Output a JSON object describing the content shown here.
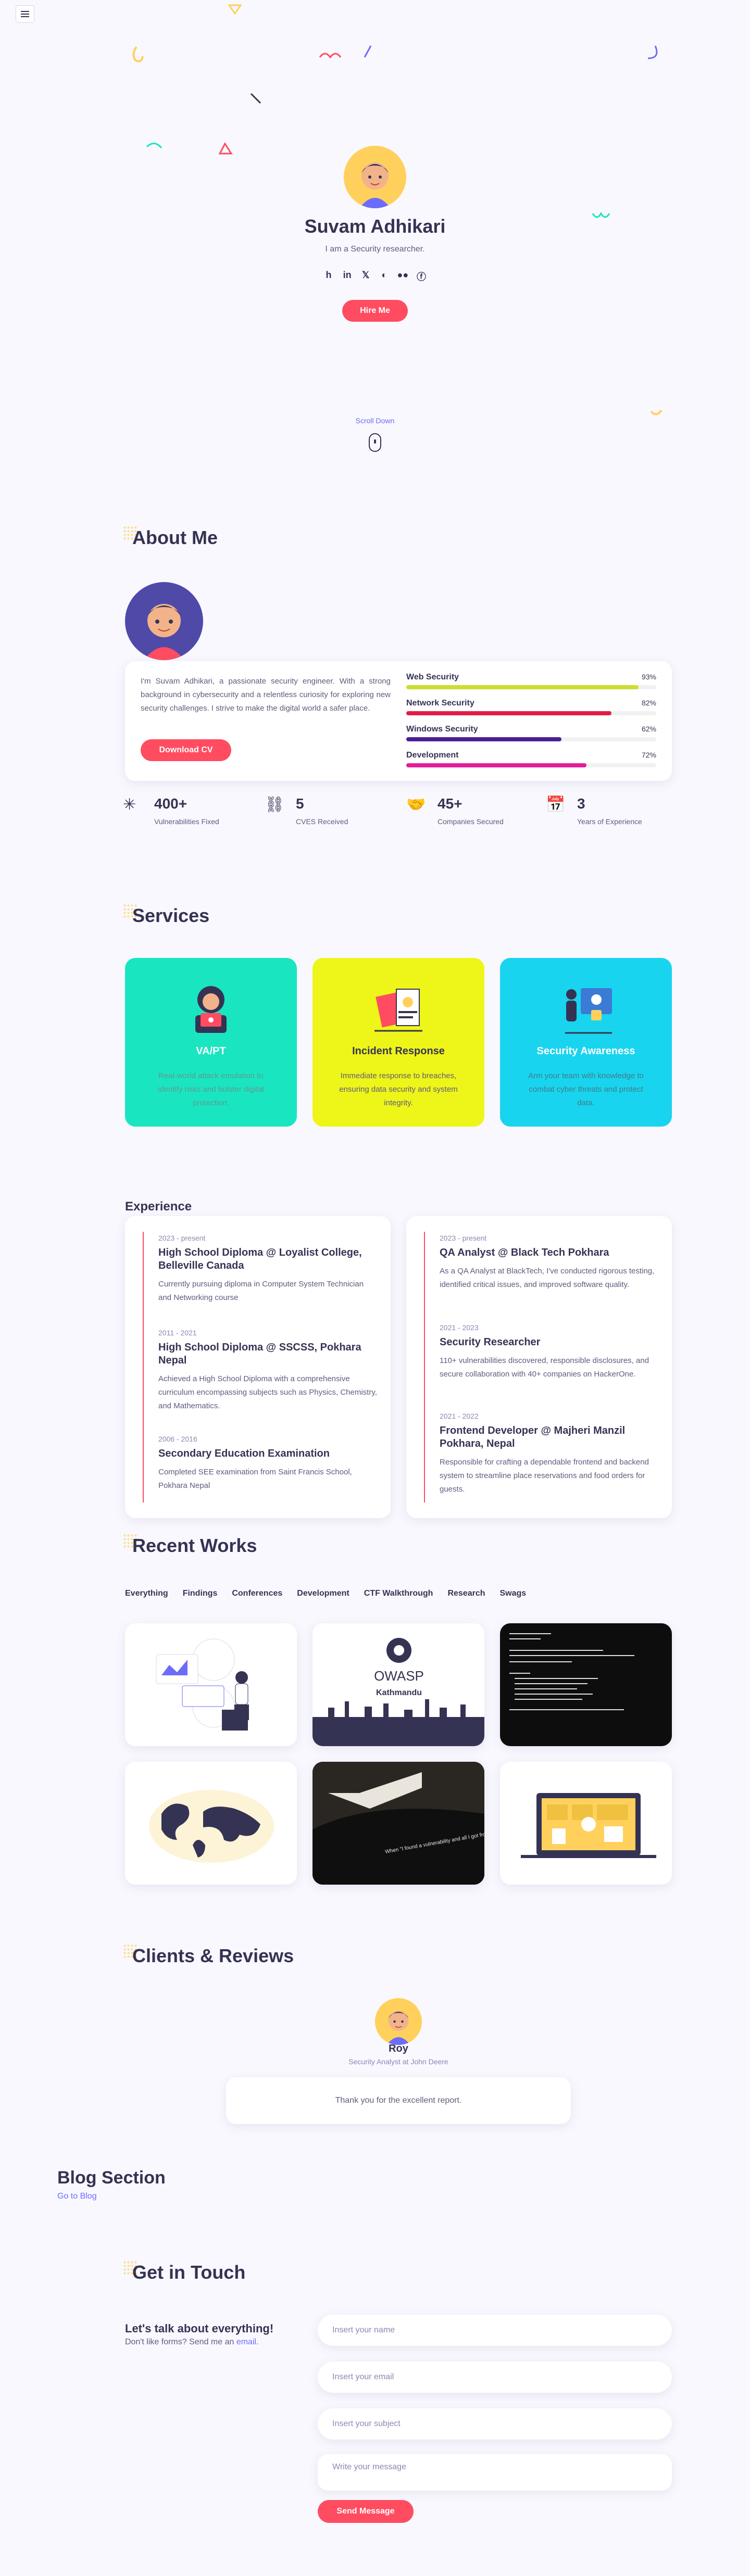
{
  "nav": {
    "menu_icon": "hamburger-icon"
  },
  "hero": {
    "name": "Suvam Adhikari",
    "role": "I am a Security researcher.",
    "hire_label": "Hire Me",
    "scroll_label": "Scroll Down",
    "socials": [
      {
        "icon": "hackerone-icon",
        "glyph": "h"
      },
      {
        "icon": "linkedin-icon",
        "glyph": "in"
      },
      {
        "icon": "x-icon",
        "glyph": "𝕏"
      },
      {
        "icon": "github-icon",
        "glyph": "◐"
      },
      {
        "icon": "medium-icon",
        "glyph": "●●"
      },
      {
        "icon": "facebook-icon",
        "glyph": "ⓕ"
      }
    ]
  },
  "about": {
    "title": "About Me",
    "text": "I'm Suvam Adhikari, a passionate security engineer. With a strong background in cybersecurity and a relentless curiosity for exploring new security challenges. I strive to make the digital world a safer place.",
    "cv_label": "Download CV",
    "skills": [
      {
        "name": "Web Security",
        "value": "93%",
        "pct": 0.93,
        "color": "#ccde2f"
      },
      {
        "name": "Network Security",
        "value": "82%",
        "pct": 0.82,
        "color": "#e11d48"
      },
      {
        "name": "Windows Security",
        "value": "62%",
        "pct": 0.62,
        "color": "#4c1d95"
      },
      {
        "name": "Development",
        "value": "72%",
        "pct": 0.72,
        "color": "#e11d9a"
      }
    ],
    "facts": [
      {
        "icon": "bug-icon",
        "glyph": "✳",
        "num": "400+",
        "label": "Vulnerabilities Fixed"
      },
      {
        "icon": "link-icon",
        "glyph": "⛓",
        "num": "5",
        "label": "CVES Received"
      },
      {
        "icon": "handshake-icon",
        "glyph": "🤝",
        "num": "45+",
        "label": "Companies Secured"
      },
      {
        "icon": "calendar-icon",
        "glyph": "📅",
        "num": "3",
        "label": "Years of Experience"
      }
    ]
  },
  "services": {
    "title": "Services",
    "items": [
      {
        "title": "VA/PT",
        "desc": "Real-world attack emulation to identify risks and bolster digital protection.",
        "bg": "#19e6c1",
        "title_color": "#ffffff",
        "desc_color": "#5f9a8f"
      },
      {
        "title": "Incident Response",
        "desc": "Immediate response to breaches, ensuring data security and system integrity.",
        "bg": "#eef518",
        "title_color": "#353353",
        "desc_color": "#5e5c7f"
      },
      {
        "title": "Security Awareness",
        "desc": "Arm your team with knowledge to combat cyber threats and protect data.",
        "bg": "#19d4ef",
        "title_color": "#ffffff",
        "desc_color": "#3f7d8a"
      }
    ]
  },
  "experience": {
    "title": "Experience",
    "left": [
      {
        "date": "2023 - present",
        "title": "High School Diploma @ Loyalist College, Belleville Canada",
        "desc": "Currently pursuing diploma in Computer System Technician and Networking course"
      },
      {
        "date": "2011 - 2021",
        "title": "High School Diploma @ SSCSS, Pokhara Nepal",
        "desc": "Achieved a High School Diploma with a comprehensive curriculum encompassing subjects such as Physics, Chemistry, and Mathematics."
      },
      {
        "date": "2006 - 2016",
        "title": "Secondary Education Examination",
        "desc": "Completed SEE examination from Saint Francis School, Pokhara Nepal"
      }
    ],
    "right": [
      {
        "date": "2023 - present",
        "title": "QA Analyst @ Black Tech Pokhara",
        "desc": "As a QA Analyst at BlackTech, I've conducted rigorous testing, identified critical issues, and improved software quality."
      },
      {
        "date": "2021 - 2023",
        "title": "Security Researcher",
        "desc": "110+ vulnerabilities discovered, responsible disclosures, and secure collaboration with 40+ companies on HackerOne."
      },
      {
        "date": "2021 - 2022",
        "title": "Frontend Developer @ Majheri Manzil Pokhara, Nepal",
        "desc": "Responsible for crafting a dependable frontend and backend system to streamline place reservations and food orders for guests."
      }
    ]
  },
  "works": {
    "title": "Recent Works",
    "filters": [
      "Everything",
      "Findings",
      "Conferences",
      "Development",
      "CTF Walkthrough",
      "Research",
      "Swags"
    ],
    "owasp_label": "OWASP",
    "owasp_sub": "Kathmandu",
    "tshirt_text": "When \"I found a vulnerability and all I got from it was this lousy shirt\""
  },
  "clients": {
    "title": "Clients & Reviews",
    "name": "Roy",
    "role": "Security Analyst at John Deere",
    "review": "Thank you for the excellent report."
  },
  "blog": {
    "title": "Blog Section",
    "link": "Go to Blog"
  },
  "contact": {
    "title": "Get in Touch",
    "heading": "Let's talk about everything!",
    "text": "Don't like forms? Send me an ",
    "link": "email",
    "text_end": ".",
    "name_ph": "Insert your name",
    "email_ph": "Insert your email",
    "subject_ph": "Insert your subject",
    "message_ph": "Write your message",
    "send_label": "Send Message"
  }
}
